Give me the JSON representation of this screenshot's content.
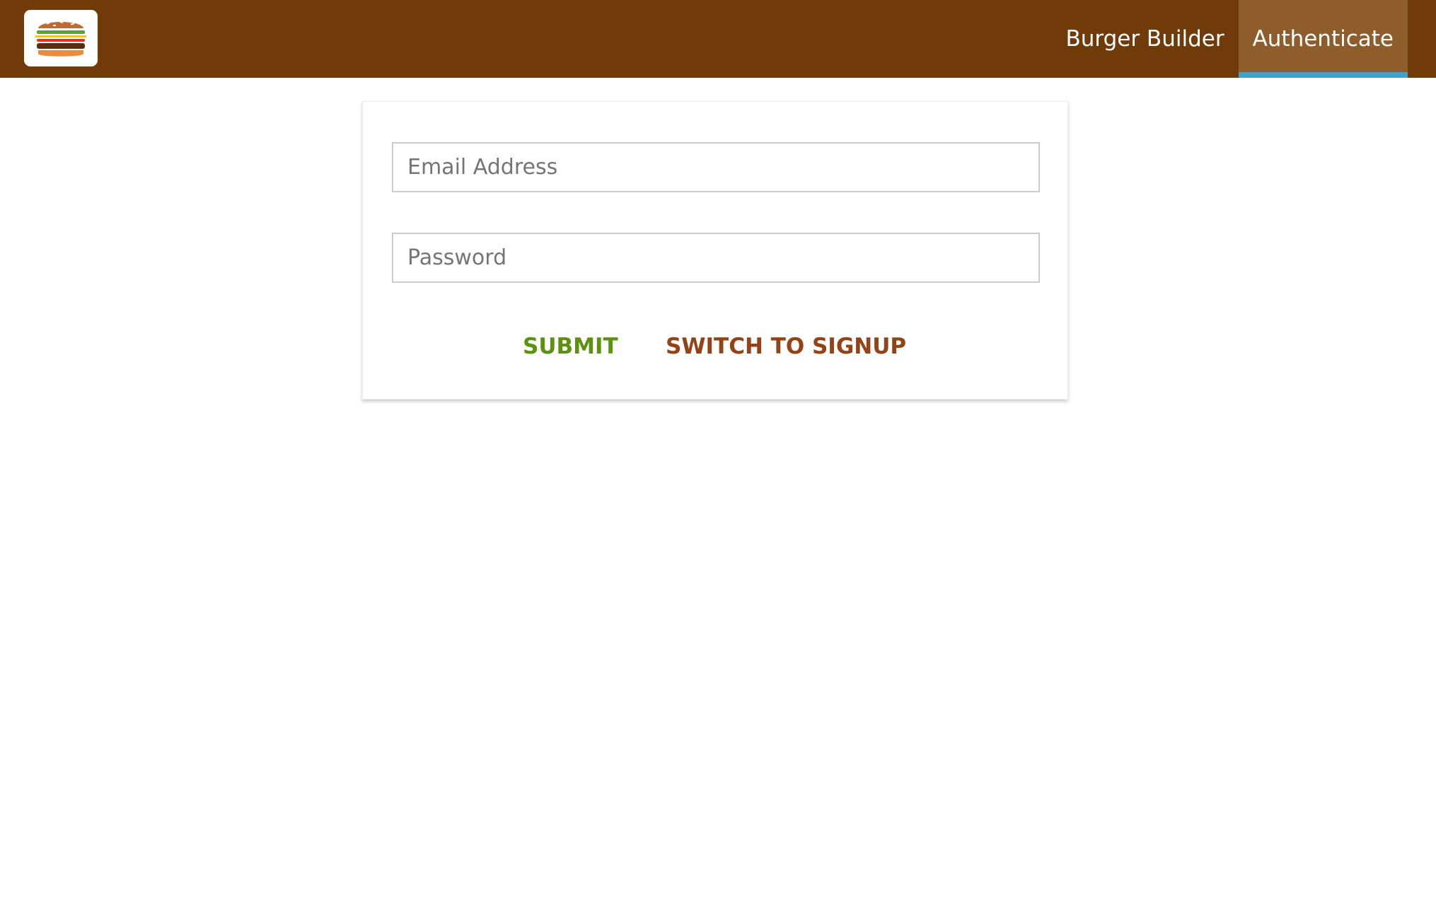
{
  "header": {
    "logo": {
      "icon": "burger-logo-icon"
    },
    "nav": [
      {
        "label": "Burger Builder",
        "active": false
      },
      {
        "label": "Authenticate",
        "active": true
      }
    ],
    "colors": {
      "toolbar_bg": "#703B09",
      "active_bg": "#8F5C2C",
      "active_indicator": "#40A4C8"
    }
  },
  "auth_form": {
    "email_placeholder": "Email Address",
    "email_value": "",
    "password_placeholder": "Password",
    "password_value": "",
    "submit_label": "SUBMIT",
    "switch_label": "SWITCH TO SIGNUP",
    "colors": {
      "submit": "#5C9210",
      "switch": "#944317"
    }
  }
}
